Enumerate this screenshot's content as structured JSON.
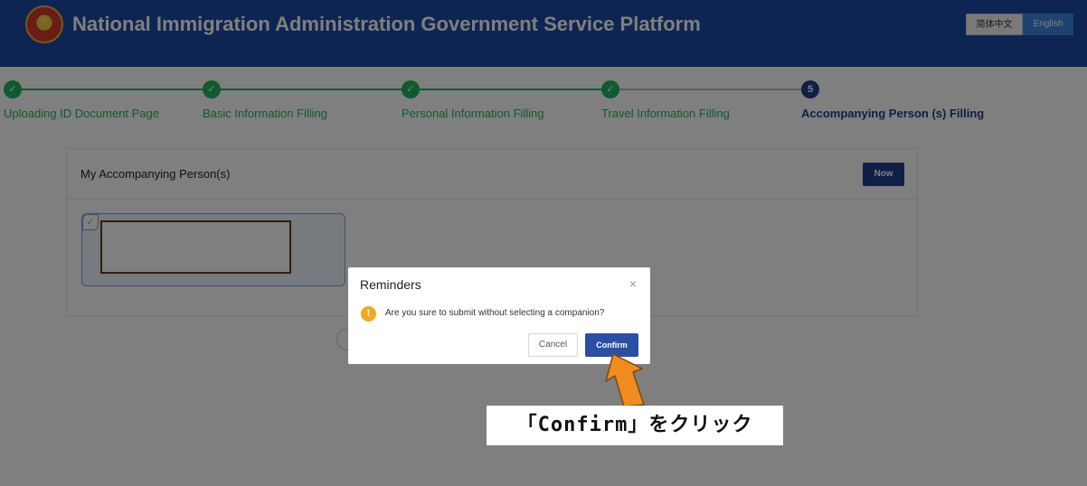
{
  "header": {
    "title": "National Immigration Administration Government Service Platform",
    "lang_zh": "简体中文",
    "lang_en": "English",
    "emblem_icon": "national-emblem-icon"
  },
  "stepper": {
    "steps": [
      {
        "number": "1",
        "label": "Uploading ID Document Page",
        "status": "done"
      },
      {
        "number": "2",
        "label": "Basic Information Filling",
        "status": "done"
      },
      {
        "number": "3",
        "label": "Personal Information Filling",
        "status": "done"
      },
      {
        "number": "4",
        "label": "Travel Information Filling",
        "status": "done"
      },
      {
        "number": "5",
        "label": "Accompanying Person (s) Filling",
        "status": "active"
      }
    ]
  },
  "card": {
    "title": "My Accompanying Person(s)",
    "now_button": "Now"
  },
  "dialog": {
    "title": "Reminders",
    "close_icon": "close-icon",
    "warning_icon": "warning-icon",
    "message": "Are you sure to submit without selecting a companion?",
    "cancel_label": "Cancel",
    "confirm_label": "Confirm"
  },
  "annotation": {
    "caption": "「Confirm」をクリック",
    "arrow_icon": "arrow-up-left-icon"
  },
  "colors": {
    "header_bg": "#1d4ba6",
    "done_green": "#22b35e",
    "active_navy": "#1e3e8c",
    "confirm_blue": "#2c4ea3",
    "arrow_orange": "#f08c1e"
  }
}
